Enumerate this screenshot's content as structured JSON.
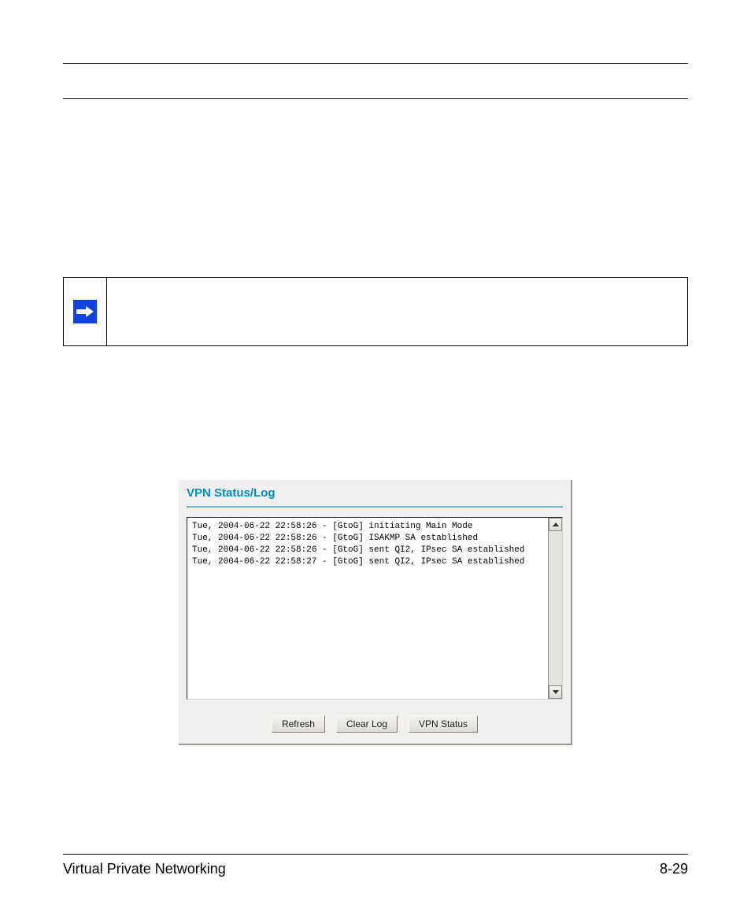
{
  "footer": {
    "section_title": "Virtual Private Networking",
    "page_number": "8-29"
  },
  "note": {
    "icon_name": "arrow-right-icon",
    "text": ""
  },
  "vpn_panel": {
    "title": "VPN Status/Log",
    "log_lines": [
      "Tue, 2004-06-22 22:58:26 - [GtoG] initiating Main Mode",
      "Tue, 2004-06-22 22:58:26 - [GtoG] ISAKMP SA established",
      "Tue, 2004-06-22 22:58:26 - [GtoG] sent QI2, IPsec SA established",
      "Tue, 2004-06-22 22:58:27 - [GtoG] sent QI2, IPsec SA established"
    ],
    "buttons": {
      "refresh": "Refresh",
      "clear_log": "Clear Log",
      "vpn_status": "VPN Status"
    }
  }
}
